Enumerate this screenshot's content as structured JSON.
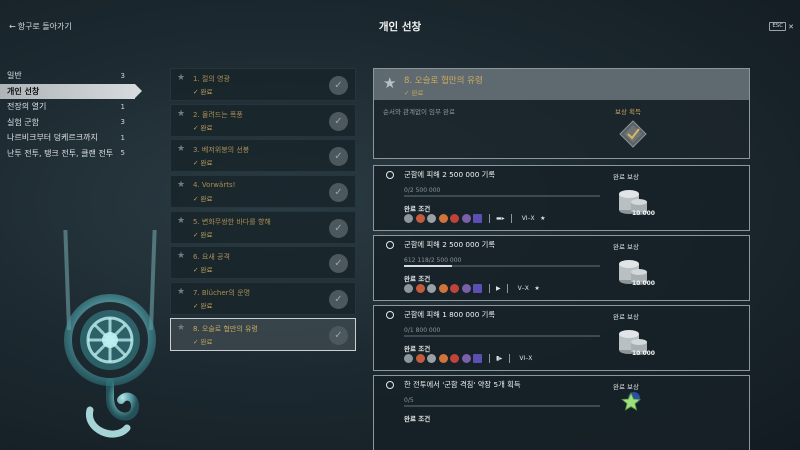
{
  "header": {
    "back_label": "항구로 돌아가기",
    "title": "개인 선창",
    "esc_key": "ESC",
    "close_glyph": "✕"
  },
  "sidebar": {
    "items": [
      {
        "label": "일반",
        "count": "3",
        "active": false
      },
      {
        "label": "개인 선창",
        "count": "",
        "active": true
      },
      {
        "label": "전장의 열기",
        "count": "1",
        "active": false
      },
      {
        "label": "실험 군함",
        "count": "3",
        "active": false
      },
      {
        "label": "나르비크부터 덩케르크까지",
        "count": "1",
        "active": false
      },
      {
        "label": "난투 전투, 탱크 전투, 클랜 전투",
        "count": "5",
        "active": false
      }
    ]
  },
  "tasks": {
    "items": [
      {
        "name": "1. 절의 영광",
        "status": "✓ 완료",
        "selected": false
      },
      {
        "name": "2. 몰려드는 폭풍",
        "status": "✓ 완료",
        "selected": false
      },
      {
        "name": "3. 베저위붕의 선봉",
        "status": "✓ 완료",
        "selected": false
      },
      {
        "name": "4. Vorwärts!",
        "status": "✓ 완료",
        "selected": false
      },
      {
        "name": "5. 변화무쌍한 바다를 향해",
        "status": "✓ 완료",
        "selected": false
      },
      {
        "name": "6. 요새 공격",
        "status": "✓ 완료",
        "selected": false
      },
      {
        "name": "7. Blücher의 운명",
        "status": "✓ 완료",
        "selected": false
      },
      {
        "name": "8. 오슬로 협만의 유령",
        "status": "✓ 완료",
        "selected": true
      }
    ]
  },
  "detail": {
    "title": "8. 오슬로 협만의 유령",
    "status": "✓ 완료",
    "description": "순서와 관계없이 임무 완료",
    "reward_label": "보상 획득"
  },
  "missions": [
    {
      "name": "군함에 피해 2 500 000 기록",
      "progress_text": "0/2 500 000",
      "progress": 0.0,
      "condition_label": "완료 조건",
      "tiers": "VI–X",
      "tail": "★",
      "reward_label": "완료 보상",
      "reward_value": "10 000",
      "reward_type": "coins"
    },
    {
      "name": "군함에 피해 2 500 000 기록",
      "progress_text": "612 118/2 500 000",
      "progress": 0.245,
      "condition_label": "완료 조건",
      "tiers": "V–X",
      "tail": "★",
      "reward_label": "완료 보상",
      "reward_value": "10 000",
      "reward_type": "coins"
    },
    {
      "name": "군함에 피해 1 800 000 기록",
      "progress_text": "0/1 800 000",
      "progress": 0.0,
      "condition_label": "완료 조건",
      "tiers": "VI–X",
      "tail": "",
      "reward_label": "완료 보상",
      "reward_value": "10 000",
      "reward_type": "coins"
    },
    {
      "name": "한 전투에서 '군함 격침' 약장 5개 획득",
      "progress_text": "0/5",
      "progress": 0.0,
      "condition_label": "완료 조건",
      "tiers": "",
      "tail": "",
      "reward_label": "완료 보상",
      "reward_value": "",
      "reward_type": "star"
    }
  ],
  "colors": {
    "accent_gold": "#c7a65c",
    "panel_border": "#8c969b",
    "selected_bar": "#d6dadc"
  },
  "icons": {
    "condition_icons": [
      "nation-icon",
      "destroyer-icon",
      "cruiser-icon",
      "battleship-icon",
      "carrier-icon",
      "submarine-icon",
      "premium-icon"
    ]
  }
}
